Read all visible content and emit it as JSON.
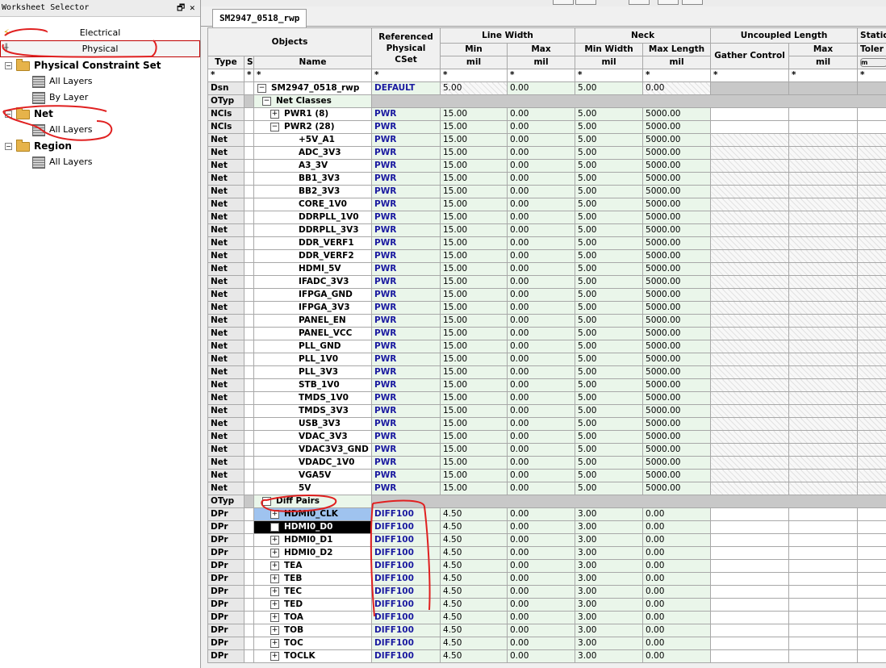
{
  "selector": {
    "title": "Worksheet Selector",
    "pin_glyph": "🗗",
    "close_glyph": "✕",
    "electrical": "Electrical",
    "physical": "Physical",
    "tree": {
      "pcs": "Physical Constraint Set",
      "pcs_all_layers": "All Layers",
      "pcs_by_layer": "By Layer",
      "net": "Net",
      "net_all_layers": "All Layers",
      "region": "Region",
      "region_all_layers": "All Layers"
    }
  },
  "tab": {
    "label": "SM2947_0518_rwp"
  },
  "headers": {
    "objects": "Objects",
    "ref_cset": "Referenced Physical CSet",
    "line_width": "Line Width",
    "min": "Min",
    "max": "Max",
    "neck": "Neck",
    "min_width": "Min Width",
    "max_length": "Max Length",
    "uncoupled": "Uncoupled Length",
    "gather": "Gather Control",
    "static": "Static",
    "toler": "Toler",
    "type": "Type",
    "s": "S",
    "name": "Name",
    "mil": "mil",
    "star": "*",
    "btn_m": "m"
  },
  "rows": [
    {
      "type": "Dsn",
      "name": "SM2947_0518_rwp",
      "cset": "DEFAULT",
      "lwmin": "5.00",
      "lwmax": "0.00",
      "nmin": "5.00",
      "nmax": "0.00",
      "kind": "dsn"
    },
    {
      "type": "OTyp",
      "name": "Net Classes",
      "kind": "otyp"
    },
    {
      "type": "NCls",
      "name": "PWR1 (8)",
      "cset": "PWR",
      "lwmin": "15.00",
      "lwmax": "0.00",
      "nmin": "5.00",
      "nmax": "5000.00",
      "kind": "ncls",
      "pm": "+"
    },
    {
      "type": "NCls",
      "name": "PWR2 (28)",
      "cset": "PWR",
      "lwmin": "15.00",
      "lwmax": "0.00",
      "nmin": "5.00",
      "nmax": "5000.00",
      "kind": "ncls",
      "pm": "−"
    },
    {
      "type": "Net",
      "name": "+5V_A1",
      "cset": "PWR",
      "lwmin": "15.00",
      "lwmax": "0.00",
      "nmin": "5.00",
      "nmax": "5000.00",
      "kind": "net"
    },
    {
      "type": "Net",
      "name": "ADC_3V3",
      "cset": "PWR",
      "lwmin": "15.00",
      "lwmax": "0.00",
      "nmin": "5.00",
      "nmax": "5000.00",
      "kind": "net"
    },
    {
      "type": "Net",
      "name": "A3_3V",
      "cset": "PWR",
      "lwmin": "15.00",
      "lwmax": "0.00",
      "nmin": "5.00",
      "nmax": "5000.00",
      "kind": "net"
    },
    {
      "type": "Net",
      "name": "BB1_3V3",
      "cset": "PWR",
      "lwmin": "15.00",
      "lwmax": "0.00",
      "nmin": "5.00",
      "nmax": "5000.00",
      "kind": "net"
    },
    {
      "type": "Net",
      "name": "BB2_3V3",
      "cset": "PWR",
      "lwmin": "15.00",
      "lwmax": "0.00",
      "nmin": "5.00",
      "nmax": "5000.00",
      "kind": "net"
    },
    {
      "type": "Net",
      "name": "CORE_1V0",
      "cset": "PWR",
      "lwmin": "15.00",
      "lwmax": "0.00",
      "nmin": "5.00",
      "nmax": "5000.00",
      "kind": "net"
    },
    {
      "type": "Net",
      "name": "DDRPLL_1V0",
      "cset": "PWR",
      "lwmin": "15.00",
      "lwmax": "0.00",
      "nmin": "5.00",
      "nmax": "5000.00",
      "kind": "net"
    },
    {
      "type": "Net",
      "name": "DDRPLL_3V3",
      "cset": "PWR",
      "lwmin": "15.00",
      "lwmax": "0.00",
      "nmin": "5.00",
      "nmax": "5000.00",
      "kind": "net"
    },
    {
      "type": "Net",
      "name": "DDR_VERF1",
      "cset": "PWR",
      "lwmin": "15.00",
      "lwmax": "0.00",
      "nmin": "5.00",
      "nmax": "5000.00",
      "kind": "net"
    },
    {
      "type": "Net",
      "name": "DDR_VERF2",
      "cset": "PWR",
      "lwmin": "15.00",
      "lwmax": "0.00",
      "nmin": "5.00",
      "nmax": "5000.00",
      "kind": "net"
    },
    {
      "type": "Net",
      "name": "HDMI_5V",
      "cset": "PWR",
      "lwmin": "15.00",
      "lwmax": "0.00",
      "nmin": "5.00",
      "nmax": "5000.00",
      "kind": "net"
    },
    {
      "type": "Net",
      "name": "IFADC_3V3",
      "cset": "PWR",
      "lwmin": "15.00",
      "lwmax": "0.00",
      "nmin": "5.00",
      "nmax": "5000.00",
      "kind": "net"
    },
    {
      "type": "Net",
      "name": "IFPGA_GND",
      "cset": "PWR",
      "lwmin": "15.00",
      "lwmax": "0.00",
      "nmin": "5.00",
      "nmax": "5000.00",
      "kind": "net"
    },
    {
      "type": "Net",
      "name": "IFPGA_3V3",
      "cset": "PWR",
      "lwmin": "15.00",
      "lwmax": "0.00",
      "nmin": "5.00",
      "nmax": "5000.00",
      "kind": "net"
    },
    {
      "type": "Net",
      "name": "PANEL_EN",
      "cset": "PWR",
      "lwmin": "15.00",
      "lwmax": "0.00",
      "nmin": "5.00",
      "nmax": "5000.00",
      "kind": "net"
    },
    {
      "type": "Net",
      "name": "PANEL_VCC",
      "cset": "PWR",
      "lwmin": "15.00",
      "lwmax": "0.00",
      "nmin": "5.00",
      "nmax": "5000.00",
      "kind": "net"
    },
    {
      "type": "Net",
      "name": "PLL_GND",
      "cset": "PWR",
      "lwmin": "15.00",
      "lwmax": "0.00",
      "nmin": "5.00",
      "nmax": "5000.00",
      "kind": "net"
    },
    {
      "type": "Net",
      "name": "PLL_1V0",
      "cset": "PWR",
      "lwmin": "15.00",
      "lwmax": "0.00",
      "nmin": "5.00",
      "nmax": "5000.00",
      "kind": "net"
    },
    {
      "type": "Net",
      "name": "PLL_3V3",
      "cset": "PWR",
      "lwmin": "15.00",
      "lwmax": "0.00",
      "nmin": "5.00",
      "nmax": "5000.00",
      "kind": "net"
    },
    {
      "type": "Net",
      "name": "STB_1V0",
      "cset": "PWR",
      "lwmin": "15.00",
      "lwmax": "0.00",
      "nmin": "5.00",
      "nmax": "5000.00",
      "kind": "net"
    },
    {
      "type": "Net",
      "name": "TMDS_1V0",
      "cset": "PWR",
      "lwmin": "15.00",
      "lwmax": "0.00",
      "nmin": "5.00",
      "nmax": "5000.00",
      "kind": "net"
    },
    {
      "type": "Net",
      "name": "TMDS_3V3",
      "cset": "PWR",
      "lwmin": "15.00",
      "lwmax": "0.00",
      "nmin": "5.00",
      "nmax": "5000.00",
      "kind": "net"
    },
    {
      "type": "Net",
      "name": "USB_3V3",
      "cset": "PWR",
      "lwmin": "15.00",
      "lwmax": "0.00",
      "nmin": "5.00",
      "nmax": "5000.00",
      "kind": "net"
    },
    {
      "type": "Net",
      "name": "VDAC_3V3",
      "cset": "PWR",
      "lwmin": "15.00",
      "lwmax": "0.00",
      "nmin": "5.00",
      "nmax": "5000.00",
      "kind": "net"
    },
    {
      "type": "Net",
      "name": "VDAC3V3_GND",
      "cset": "PWR",
      "lwmin": "15.00",
      "lwmax": "0.00",
      "nmin": "5.00",
      "nmax": "5000.00",
      "kind": "net"
    },
    {
      "type": "Net",
      "name": "VDADC_1V0",
      "cset": "PWR",
      "lwmin": "15.00",
      "lwmax": "0.00",
      "nmin": "5.00",
      "nmax": "5000.00",
      "kind": "net"
    },
    {
      "type": "Net",
      "name": "VGA5V",
      "cset": "PWR",
      "lwmin": "15.00",
      "lwmax": "0.00",
      "nmin": "5.00",
      "nmax": "5000.00",
      "kind": "net"
    },
    {
      "type": "Net",
      "name": "5V",
      "cset": "PWR",
      "lwmin": "15.00",
      "lwmax": "0.00",
      "nmin": "5.00",
      "nmax": "5000.00",
      "kind": "net"
    },
    {
      "type": "OTyp",
      "name": "Diff Pairs",
      "kind": "otyp"
    },
    {
      "type": "DPr",
      "name": "HDMI0_CLK",
      "cset": "DIFF100",
      "lwmin": "4.50",
      "lwmax": "0.00",
      "nmin": "3.00",
      "nmax": "0.00",
      "kind": "dpr",
      "sel": "blue"
    },
    {
      "type": "DPr",
      "name": "HDMI0_D0",
      "cset": "DIFF100",
      "lwmin": "4.50",
      "lwmax": "0.00",
      "nmin": "3.00",
      "nmax": "0.00",
      "kind": "dpr",
      "sel": "black"
    },
    {
      "type": "DPr",
      "name": "HDMI0_D1",
      "cset": "DIFF100",
      "lwmin": "4.50",
      "lwmax": "0.00",
      "nmin": "3.00",
      "nmax": "0.00",
      "kind": "dpr"
    },
    {
      "type": "DPr",
      "name": "HDMI0_D2",
      "cset": "DIFF100",
      "lwmin": "4.50",
      "lwmax": "0.00",
      "nmin": "3.00",
      "nmax": "0.00",
      "kind": "dpr"
    },
    {
      "type": "DPr",
      "name": "TEA",
      "cset": "DIFF100",
      "lwmin": "4.50",
      "lwmax": "0.00",
      "nmin": "3.00",
      "nmax": "0.00",
      "kind": "dpr"
    },
    {
      "type": "DPr",
      "name": "TEB",
      "cset": "DIFF100",
      "lwmin": "4.50",
      "lwmax": "0.00",
      "nmin": "3.00",
      "nmax": "0.00",
      "kind": "dpr"
    },
    {
      "type": "DPr",
      "name": "TEC",
      "cset": "DIFF100",
      "lwmin": "4.50",
      "lwmax": "0.00",
      "nmin": "3.00",
      "nmax": "0.00",
      "kind": "dpr"
    },
    {
      "type": "DPr",
      "name": "TED",
      "cset": "DIFF100",
      "lwmin": "4.50",
      "lwmax": "0.00",
      "nmin": "3.00",
      "nmax": "0.00",
      "kind": "dpr"
    },
    {
      "type": "DPr",
      "name": "TOA",
      "cset": "DIFF100",
      "lwmin": "4.50",
      "lwmax": "0.00",
      "nmin": "3.00",
      "nmax": "0.00",
      "kind": "dpr"
    },
    {
      "type": "DPr",
      "name": "TOB",
      "cset": "DIFF100",
      "lwmin": "4.50",
      "lwmax": "0.00",
      "nmin": "3.00",
      "nmax": "0.00",
      "kind": "dpr"
    },
    {
      "type": "DPr",
      "name": "TOC",
      "cset": "DIFF100",
      "lwmin": "4.50",
      "lwmax": "0.00",
      "nmin": "3.00",
      "nmax": "0.00",
      "kind": "dpr"
    },
    {
      "type": "DPr",
      "name": "TOCLK",
      "cset": "DIFF100",
      "lwmin": "4.50",
      "lwmax": "0.00",
      "nmin": "3.00",
      "nmax": "0.00",
      "kind": "dpr"
    }
  ],
  "colors": {
    "annotation_red": "#e02020",
    "cset_blue": "#1a1aa0",
    "selection_blue": "#9fc3ef"
  }
}
